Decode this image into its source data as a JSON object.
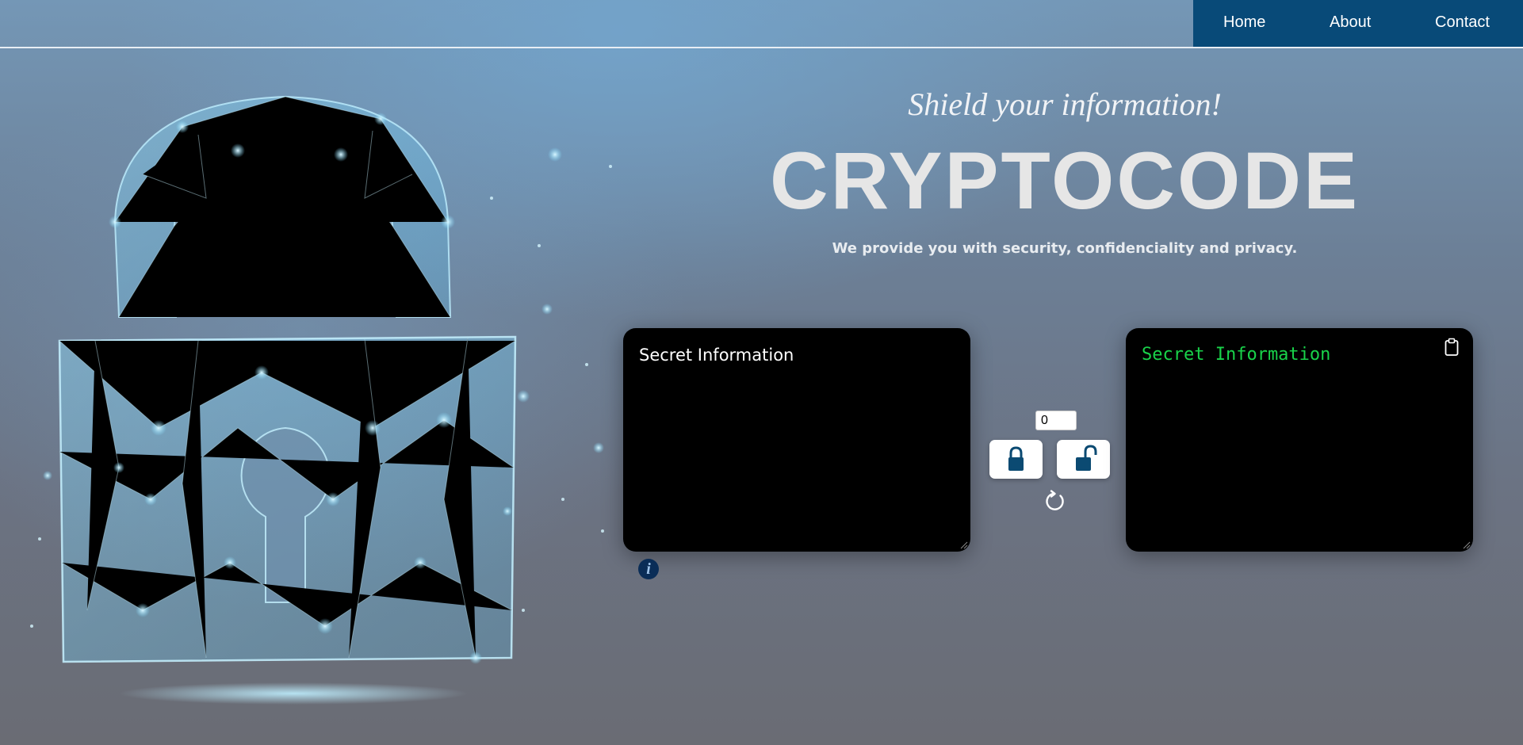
{
  "nav": {
    "items": [
      {
        "label": "Home"
      },
      {
        "label": "About"
      },
      {
        "label": "Contact"
      }
    ],
    "background_color": "#084a78"
  },
  "hero": {
    "tagline": "Shield your information!",
    "brand": "CRYPTOCODE",
    "subtitle": "We provide you with security, confidenciality and privacy."
  },
  "input_panel": {
    "placeholder": "Secret Information",
    "text_color": "#ffffff"
  },
  "output_panel": {
    "text": "Secret Information",
    "text_color": "#19d34a",
    "copy_icon": "clipboard-icon"
  },
  "controls": {
    "key_value": "0",
    "encrypt_icon": "lock-closed-icon",
    "decrypt_icon": "lock-open-icon",
    "reset_icon": "refresh-icon",
    "info_icon": "info-icon",
    "info_label": "i"
  },
  "colors": {
    "accent": "#084a78",
    "panel_background": "#000000"
  }
}
